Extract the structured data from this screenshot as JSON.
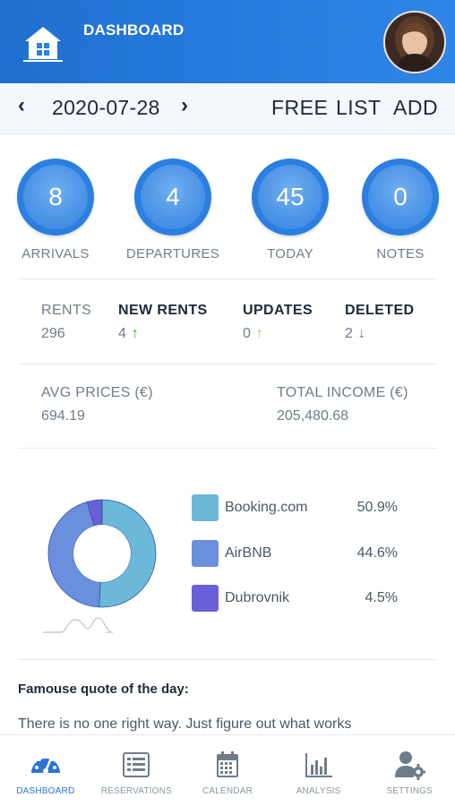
{
  "header": {
    "title": "DASHBOARD",
    "home_icon": "house-icon",
    "avatar_icon": "user-avatar"
  },
  "date_bar": {
    "date": "2020-07-28",
    "prev_glyph": "‹",
    "next_glyph": "›",
    "links": [
      "FREE",
      "LIST",
      "ADD"
    ]
  },
  "stats": [
    {
      "value": "8",
      "label": "ARRIVALS"
    },
    {
      "value": "4",
      "label": "DEPARTURES"
    },
    {
      "value": "45",
      "label": "TODAY"
    },
    {
      "value": "0",
      "label": "NOTES"
    }
  ],
  "rents": [
    {
      "label": "RENTS",
      "value": "296"
    },
    {
      "label": "NEW RENTS",
      "value": "4",
      "arrow": "↑",
      "arrow_color": "#2e9e4a"
    },
    {
      "label": "UPDATES",
      "value": "0",
      "arrow": "↑",
      "arrow_color": "#f0a53a"
    },
    {
      "label": "DELETED",
      "value": "2",
      "arrow": "↓",
      "arrow_color": "#d8434a"
    }
  ],
  "prices": {
    "avg_label": "AVG PRICES (€)",
    "avg_value": "694.19",
    "total_label": "TOTAL INCOME (€)",
    "total_value": "205,480.68"
  },
  "chart_data": {
    "type": "pie",
    "categories": [
      "Booking.com",
      "AirBNB",
      "Dubrovnik"
    ],
    "values": [
      50.9,
      44.6,
      4.5
    ],
    "value_labels": [
      "50.9%",
      "44.6%",
      "4.5%"
    ],
    "colors": [
      "#6cb8d8",
      "#6a8fdc",
      "#6a5fd6"
    ],
    "title": "",
    "legend": "right"
  },
  "quote": {
    "title": "Famouse quote of the day:",
    "text": "There is no one right way. Just figure out what works"
  },
  "bottom_nav": [
    {
      "label": "DASHBOARD",
      "icon": "gauge-icon",
      "active": true
    },
    {
      "label": "RESERVATIONS",
      "icon": "list-icon",
      "active": false
    },
    {
      "label": "CALENDAR",
      "icon": "calendar-icon",
      "active": false
    },
    {
      "label": "ANALYSIS",
      "icon": "bar-chart-icon",
      "active": false
    },
    {
      "label": "SETTINGS",
      "icon": "user-gear-icon",
      "active": false
    }
  ],
  "colors": {
    "header_start": "#1f6fd1",
    "header_end": "#2f86e6",
    "accent": "#2a74d4"
  }
}
